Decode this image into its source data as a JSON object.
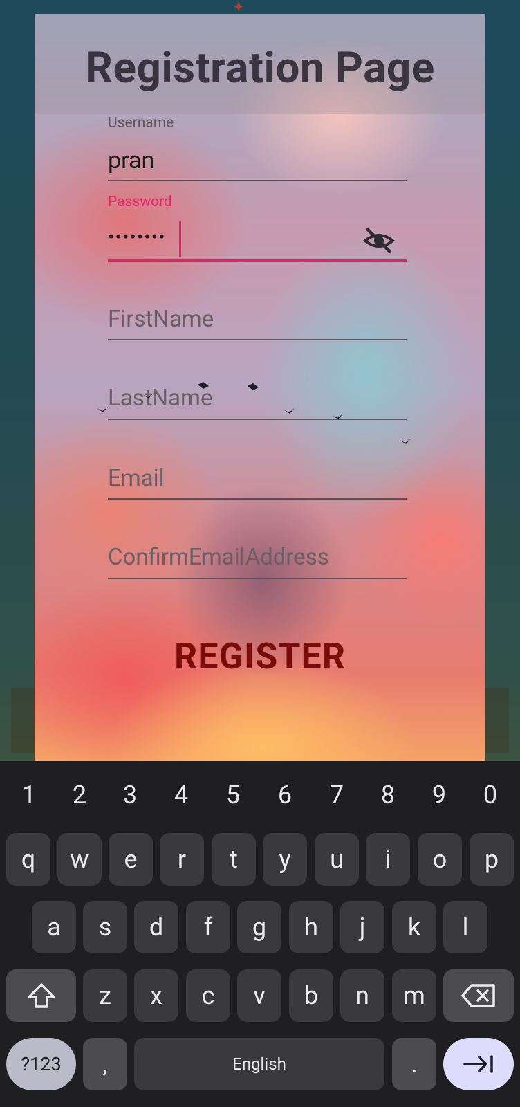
{
  "app": {
    "title": "Registration Page"
  },
  "form": {
    "username": {
      "label": "Username",
      "value": "pran"
    },
    "password": {
      "label": "Password",
      "value": "••••••••",
      "toggle_icon": "eye-off-icon"
    },
    "first_name": {
      "placeholder": "FirstName"
    },
    "last_name": {
      "placeholder": "LastName"
    },
    "email": {
      "placeholder": "Email"
    },
    "confirm_email": {
      "placeholder": "ConfirmEmailAddress"
    },
    "register_label": "REGISTER"
  },
  "keyboard": {
    "numbers": [
      "1",
      "2",
      "3",
      "4",
      "5",
      "6",
      "7",
      "8",
      "9",
      "0"
    ],
    "row1": [
      "q",
      "w",
      "e",
      "r",
      "t",
      "y",
      "u",
      "i",
      "o",
      "p"
    ],
    "row2": [
      "a",
      "s",
      "d",
      "f",
      "g",
      "h",
      "j",
      "k",
      "l"
    ],
    "row3": [
      "z",
      "x",
      "c",
      "v",
      "b",
      "n",
      "m"
    ],
    "symbols_label": "?123",
    "comma_label": ",",
    "space_label": "English",
    "period_label": ".",
    "shift_icon": "shift-icon",
    "backspace_icon": "backspace-icon",
    "enter_icon": "next-icon"
  },
  "colors": {
    "accent": "#e3246d",
    "register_text": "#7a0d0a",
    "keyboard_bg": "#1f1f22",
    "key_bg": "#3a3a3e"
  }
}
